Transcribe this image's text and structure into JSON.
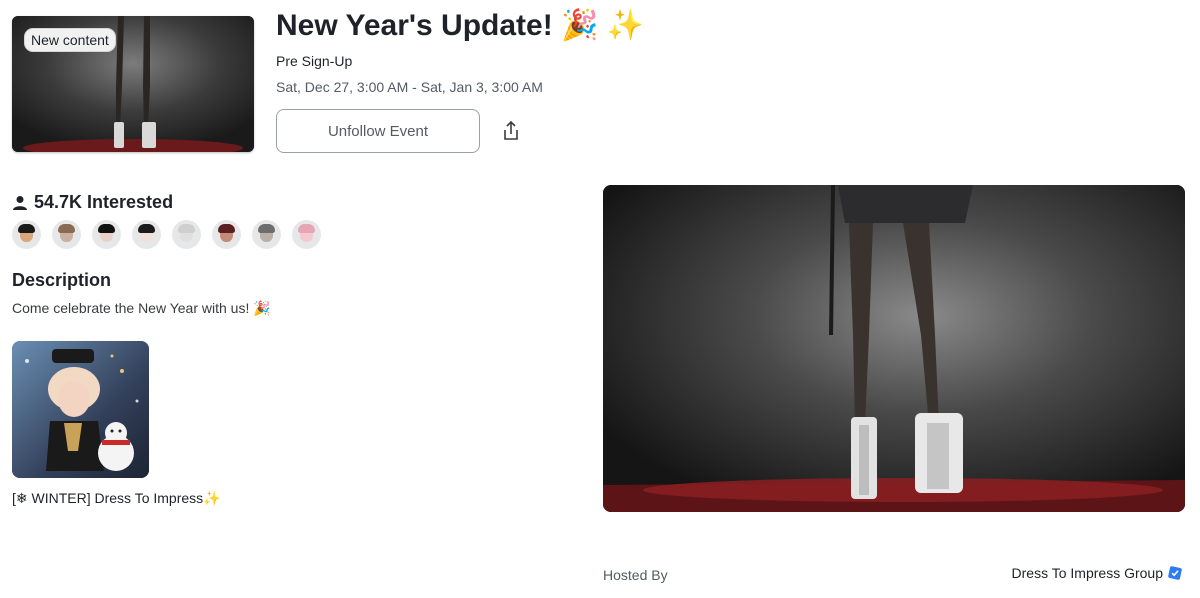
{
  "event": {
    "badge": "New content",
    "title": "New Year's Update! 🎉 ✨",
    "subtitle": "Pre Sign-Up",
    "dates": "Sat, Dec 27, 3:00 AM - Sat, Jan 3, 3:00 AM",
    "unfollow_label": "Unfollow Event"
  },
  "interested": {
    "count_label": "54.7K Interested",
    "avatars": [
      {
        "skin": "#d9a77a",
        "hair": "#1a1a1a"
      },
      {
        "skin": "#c9b0a0",
        "hair": "#8a6a55"
      },
      {
        "skin": "#e8d2c8",
        "hair": "#111111"
      },
      {
        "skin": "#f0e0d8",
        "hair": "#1b1b1b"
      },
      {
        "skin": "#e0e0e0",
        "hair": "#cfcfcf"
      },
      {
        "skin": "#c48a78",
        "hair": "#5a2020"
      },
      {
        "skin": "#b9b0a8",
        "hair": "#6d6d6d"
      },
      {
        "skin": "#f4c9d2",
        "hair": "#e4a5b5"
      }
    ]
  },
  "description": {
    "heading": "Description",
    "text": "Come celebrate the New Year with us! 🎉"
  },
  "experience": {
    "name": "[❄ WINTER] Dress To Impress✨"
  },
  "host": {
    "label": "Hosted By",
    "name": "Dress To Impress Group"
  },
  "colors": {
    "verified_blue": "#2c7cf6",
    "stage_red": "#8a1f22"
  }
}
